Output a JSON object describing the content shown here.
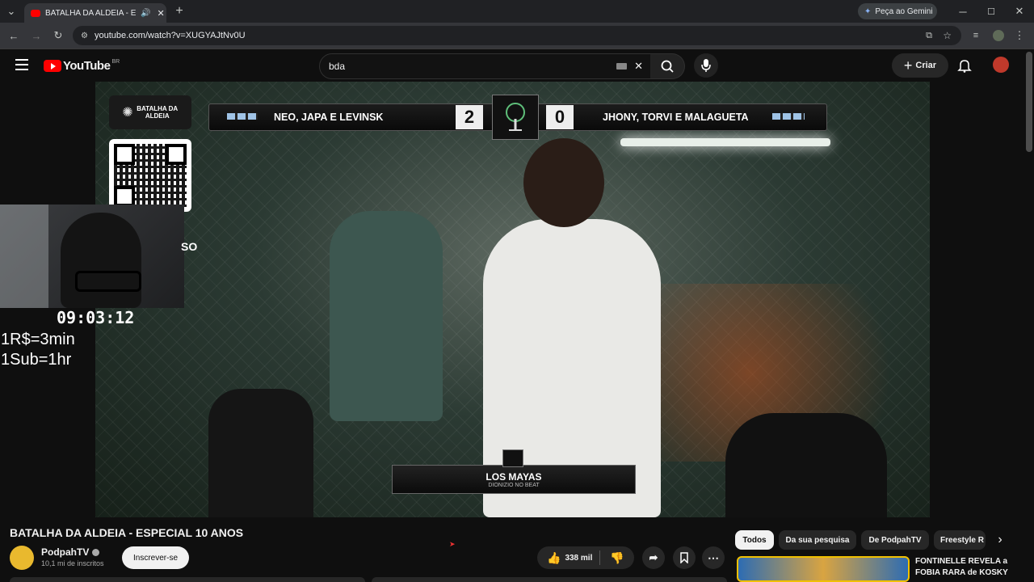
{
  "browser": {
    "tab_title": "BATALHA DA ALDEIA - ESPE",
    "url": "youtube.com/watch?v=XUGYAJtNv0U",
    "gemini_label": "Peça ao Gemini"
  },
  "youtube": {
    "logo_text": "YouTube",
    "country_code": "BR",
    "search_value": "bda",
    "create_label": "Criar"
  },
  "video": {
    "scoreboard": {
      "left_team": "NEO, JAPA E LEVINSK",
      "left_score": "2",
      "right_score": "0",
      "right_team": "JHONY, TORVI E MALAGUETA"
    },
    "logo_text": "BATALHA DA ALDEIA",
    "lower_third_title": "LOS MAYAS",
    "lower_third_sub": "DIONIZIO NO BEAT",
    "stream_timer": "09:03:12",
    "rate_line1": "1R$=3min",
    "rate_line2": "1Sub=1hr",
    "partial_text": "SO"
  },
  "info": {
    "title": "BATALHA DA ALDEIA - ESPECIAL 10 ANOS",
    "channel": "PodpahTV",
    "subscribers": "10,1 mi de inscritos",
    "subscribe_label": "Inscrever-se",
    "likes": "338 mil"
  },
  "chips": [
    "Todos",
    "Da sua pesquisa",
    "De PodpahTV",
    "Freestyle R"
  ],
  "recommended": {
    "title_line1": "FONTINELLE REVELA a",
    "title_line2": "FOBIA RARA de KOSKY"
  }
}
